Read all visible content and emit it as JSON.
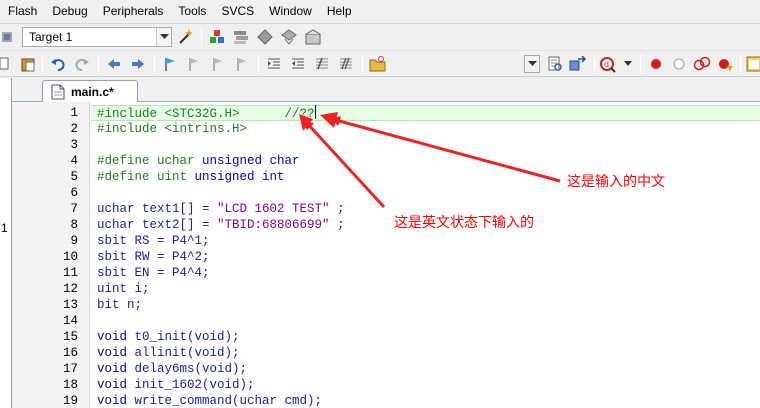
{
  "menu": {
    "items": [
      "Flash",
      "Debug",
      "Peripherals",
      "Tools",
      "SVCS",
      "Window",
      "Help"
    ]
  },
  "toolbar": {
    "target": "Target 1"
  },
  "project_panel": {
    "visible_number": "1"
  },
  "editor": {
    "tab_label": "main.c*",
    "lines": [
      {
        "num": "1",
        "tokens": [
          {
            "t": "pp",
            "v": "#include <STC32G.H>      "
          },
          {
            "t": "cmt",
            "v": "//??"
          }
        ]
      },
      {
        "num": "2",
        "tokens": [
          {
            "t": "pp",
            "v": "#include <intrins.H>"
          }
        ]
      },
      {
        "num": "3",
        "tokens": []
      },
      {
        "num": "4",
        "tokens": [
          {
            "t": "pp",
            "v": "#define uchar "
          },
          {
            "t": "kw",
            "v": "unsigned char"
          }
        ]
      },
      {
        "num": "5",
        "tokens": [
          {
            "t": "pp",
            "v": "#define uint "
          },
          {
            "t": "kw",
            "v": "unsigned int"
          }
        ]
      },
      {
        "num": "6",
        "tokens": []
      },
      {
        "num": "7",
        "tokens": [
          {
            "t": "plain",
            "v": "uchar text1[] = "
          },
          {
            "t": "str",
            "v": "\"LCD 1602 TEST\""
          },
          {
            "t": "plain",
            "v": " ;"
          }
        ]
      },
      {
        "num": "8",
        "tokens": [
          {
            "t": "plain",
            "v": "uchar text2[] = "
          },
          {
            "t": "str",
            "v": "\"TBID:68806699\""
          },
          {
            "t": "plain",
            "v": " ;"
          }
        ]
      },
      {
        "num": "9",
        "tokens": [
          {
            "t": "plain",
            "v": "sbit RS = P4^1;"
          }
        ]
      },
      {
        "num": "10",
        "tokens": [
          {
            "t": "plain",
            "v": "sbit RW = P4^2;"
          }
        ]
      },
      {
        "num": "11",
        "tokens": [
          {
            "t": "plain",
            "v": "sbit EN = P4^4;"
          }
        ]
      },
      {
        "num": "12",
        "tokens": [
          {
            "t": "plain",
            "v": "uint i;"
          }
        ]
      },
      {
        "num": "13",
        "tokens": [
          {
            "t": "plain",
            "v": "bit n;"
          }
        ]
      },
      {
        "num": "14",
        "tokens": []
      },
      {
        "num": "15",
        "tokens": [
          {
            "t": "kw",
            "v": "void"
          },
          {
            "t": "plain",
            "v": " t0_init(void);"
          }
        ]
      },
      {
        "num": "16",
        "tokens": [
          {
            "t": "kw",
            "v": "void"
          },
          {
            "t": "plain",
            "v": " allinit(void);"
          }
        ]
      },
      {
        "num": "17",
        "tokens": [
          {
            "t": "kw",
            "v": "void"
          },
          {
            "t": "plain",
            "v": " delay6ms(void);"
          }
        ]
      },
      {
        "num": "18",
        "tokens": [
          {
            "t": "kw",
            "v": "void"
          },
          {
            "t": "plain",
            "v": " init_1602(void);"
          }
        ]
      },
      {
        "num": "19",
        "tokens": [
          {
            "t": "kw",
            "v": "void"
          },
          {
            "t": "plain",
            "v": " write_command(uchar cmd);"
          }
        ]
      }
    ]
  },
  "annotations": {
    "chinese_input": "这是输入的中文",
    "english_input": "这是英文状态下输入的"
  },
  "colors": {
    "preprocessor": "#1a7f1a",
    "keyword": "#0000c8",
    "string": "#8b008b",
    "code": "#1a1aa6",
    "annotation": "#ff0000",
    "current_line": "#e6ffe6"
  }
}
